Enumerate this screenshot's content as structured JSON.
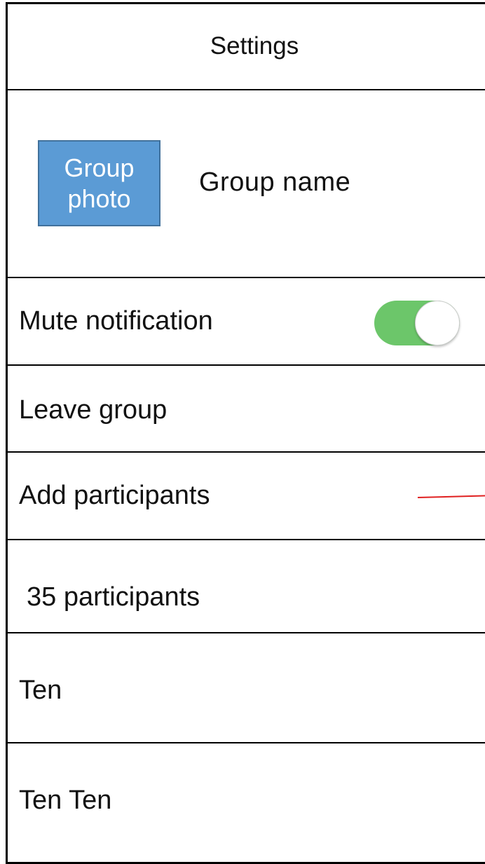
{
  "header": {
    "title": "Settings"
  },
  "group": {
    "photo_label": "Group photo",
    "name": "Group name"
  },
  "settings": {
    "mute_label": "Mute notification",
    "mute_enabled": true,
    "leave_label": "Leave group",
    "add_label": "Add participants"
  },
  "participants": {
    "count_label": "35 participants",
    "list": [
      {
        "name": "Ten"
      },
      {
        "name": "Ten Ten"
      }
    ]
  },
  "colors": {
    "toggle_on": "#6cc66a",
    "photo_bg": "#5b9bd5",
    "photo_border": "#41719c",
    "annotation_line": "#e02020"
  }
}
